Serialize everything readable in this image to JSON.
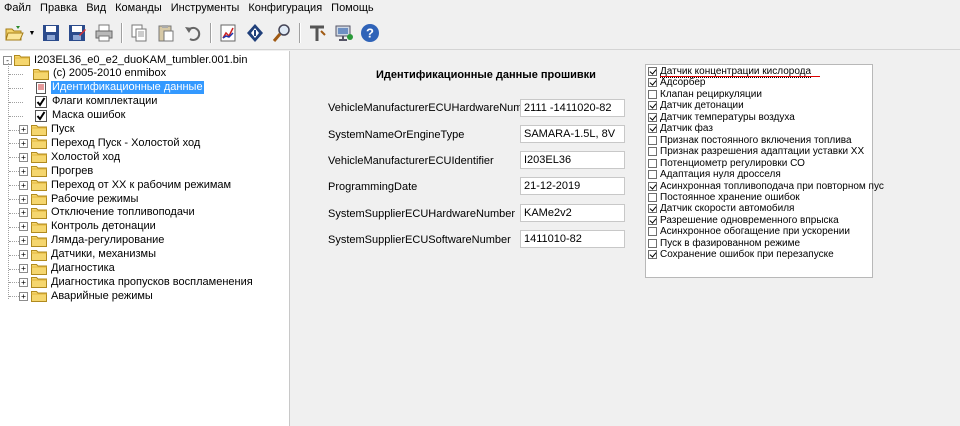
{
  "menu": [
    "Файл",
    "Правка",
    "Вид",
    "Команды",
    "Инструменты",
    "Конфигурация",
    "Помощь"
  ],
  "toolbar": {
    "buttons": [
      "open-icon",
      "save-icon",
      "save-as-icon",
      "print-icon",
      "copy-icon",
      "paste-icon",
      "undo-icon",
      "chart-icon",
      "diamond-icon",
      "search-icon",
      "tools-icon",
      "connect-icon",
      "help-icon"
    ]
  },
  "tree": {
    "root": "I203EL36_e0_e2_duoKAM_tumbler.001.bin",
    "items": [
      {
        "label": "(c) 2005-2010 enmibox",
        "kind": "folder-leaf"
      },
      {
        "label": "Идентификационные данные",
        "kind": "doc",
        "selected": true
      },
      {
        "label": "Флаги комплектации",
        "kind": "check"
      },
      {
        "label": "Маска ошибок",
        "kind": "check"
      },
      {
        "label": "Пуск",
        "kind": "folder"
      },
      {
        "label": "Переход Пуск - Холостой ход",
        "kind": "folder"
      },
      {
        "label": "Холостой ход",
        "kind": "folder"
      },
      {
        "label": "Прогрев",
        "kind": "folder"
      },
      {
        "label": "Переход от ХХ к рабочим режимам",
        "kind": "folder"
      },
      {
        "label": "Рабочие режимы",
        "kind": "folder"
      },
      {
        "label": "Отключение топливоподачи",
        "kind": "folder"
      },
      {
        "label": "Контроль детонации",
        "kind": "folder"
      },
      {
        "label": "Лямда-регулирование",
        "kind": "folder"
      },
      {
        "label": "Датчики, механизмы",
        "kind": "folder"
      },
      {
        "label": "Диагностика",
        "kind": "folder"
      },
      {
        "label": "Диагностика пропусков воспламенения",
        "kind": "folder"
      },
      {
        "label": "Аварийные режимы",
        "kind": "folder"
      }
    ]
  },
  "panel": {
    "title": "Идентификационные данные прошивки",
    "fields": [
      {
        "label": "VehicleManufacturerECUHardwareNumber",
        "value": "2111 -1411020-82"
      },
      {
        "label": "SystemNameOrEngineType",
        "value": "SAMARA-1.5L, 8V"
      },
      {
        "label": "VehicleManufacturerECUIdentifier",
        "value": "I203EL36"
      },
      {
        "label": "ProgrammingDate",
        "value": "21-12-2019"
      },
      {
        "label": "SystemSupplierECUHardwareNumber",
        "value": "KAMe2v2"
      },
      {
        "label": "SystemSupplierECUSoftwareNumber",
        "value": "1411010-82"
      }
    ]
  },
  "flags": [
    {
      "label": "Датчик концентрации кислорода",
      "checked": true
    },
    {
      "label": "Адсорбер",
      "checked": true
    },
    {
      "label": "Клапан рециркуляции",
      "checked": false
    },
    {
      "label": "Датчик детонации",
      "checked": true
    },
    {
      "label": "Датчик температуры воздуха",
      "checked": true
    },
    {
      "label": "Датчик фаз",
      "checked": true
    },
    {
      "label": "Признак постоянного включения топлива",
      "checked": false
    },
    {
      "label": "Признак разрешения адаптации уставки ХХ",
      "checked": false
    },
    {
      "label": "Потенциометр регулировки СО",
      "checked": false
    },
    {
      "label": "Адаптация нуля дросселя",
      "checked": false
    },
    {
      "label": "Асинхронная топливоподача при повторном пус",
      "checked": true
    },
    {
      "label": "Постоянное хранение ошибок",
      "checked": false
    },
    {
      "label": "Датчик скорости автомобиля",
      "checked": true
    },
    {
      "label": "Разрешение одновременного впрыска",
      "checked": true
    },
    {
      "label": "Асинхронное обогащение при ускорении",
      "checked": false
    },
    {
      "label": "Пуск в фазированном режиме",
      "checked": false
    },
    {
      "label": "Сохранение ошибок при перезапуске",
      "checked": true
    }
  ]
}
